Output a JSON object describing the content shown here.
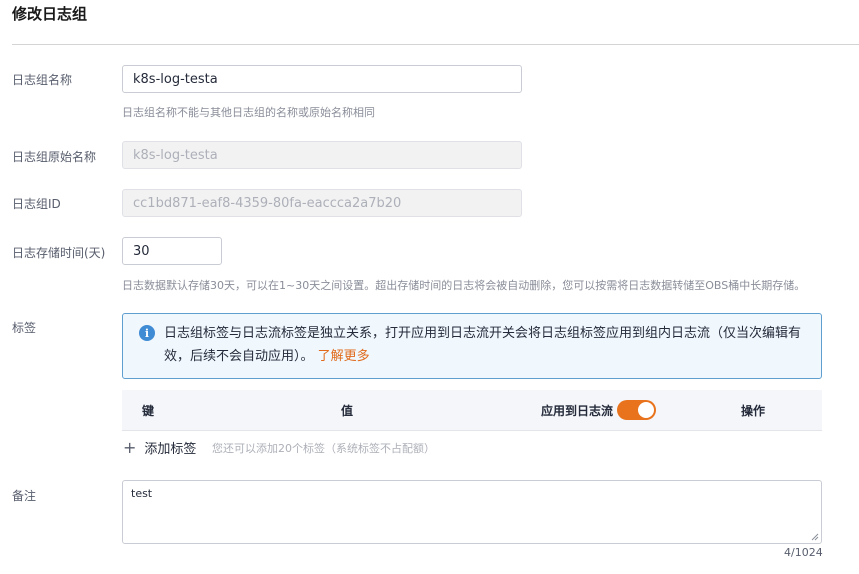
{
  "page": {
    "title": "修改日志组"
  },
  "fields": {
    "name": {
      "label": "日志组名称",
      "value": "k8s-log-testa",
      "hint": "日志组名称不能与其他日志组的名称或原始名称相同"
    },
    "original_name": {
      "label": "日志组原始名称",
      "value": "k8s-log-testa"
    },
    "id": {
      "label": "日志组ID",
      "value": "cc1bd871-eaf8-4359-80fa-eaccca2a7b20"
    },
    "retention": {
      "label": "日志存储时间(天)",
      "value": "30",
      "hint": "日志数据默认存储30天，可以在1~30天之间设置。超出存储时间的日志将会被自动删除，您可以按需将日志数据转储至OBS桶中长期存储。"
    }
  },
  "tags": {
    "label": "标签",
    "info_text": "日志组标签与日志流标签是独立关系，打开应用到日志流开关会将日志组标签应用到组内日志流（仅当次编辑有效，后续不会自动应用）。",
    "info_link": "了解更多",
    "columns": {
      "key": "键",
      "value": "值",
      "apply": "应用到日志流",
      "action": "操作"
    },
    "apply_toggle_on": true,
    "add_label": "添加标签",
    "add_hint": "您还可以添加20个标签（系统标签不占配额）"
  },
  "remark": {
    "label": "备注",
    "value": "test",
    "counter": "4/1024"
  },
  "colors": {
    "accent": "#e8731c",
    "info_border": "#5e9fcf",
    "info_bg": "#f0f7fd"
  }
}
